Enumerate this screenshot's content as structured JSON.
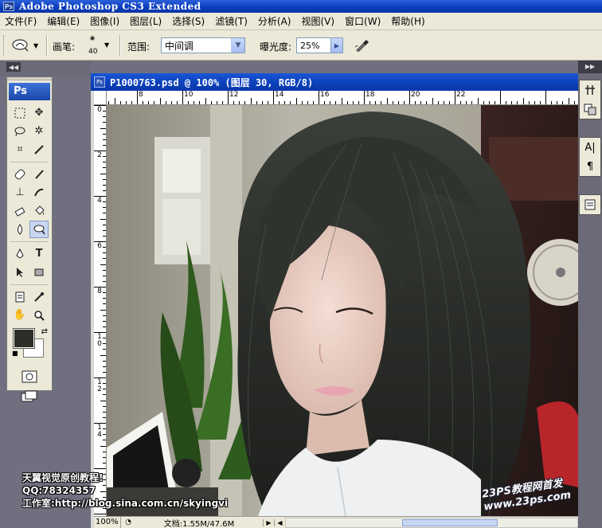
{
  "app": {
    "title": "Adobe Photoshop CS3 Extended",
    "logo": "Ps"
  },
  "menu": [
    "文件(F)",
    "编辑(E)",
    "图像(I)",
    "图层(L)",
    "选择(S)",
    "滤镜(T)",
    "分析(A)",
    "视图(V)",
    "窗口(W)",
    "帮助(H)"
  ],
  "options": {
    "tool_icon": "burn-tool-icon",
    "brush_label": "画笔:",
    "brush_size": "40",
    "range_label": "范围:",
    "range_value": "中间调",
    "exposure_label": "曝光度:",
    "exposure_value": "25%",
    "airbrush_icon": "airbrush-icon"
  },
  "toolbox": {
    "badge": "Ps",
    "tools": [
      [
        "marquee-tool-icon",
        "move-tool-icon"
      ],
      [
        "lasso-tool-icon",
        "magic-wand-tool-icon"
      ],
      [
        "crop-tool-icon",
        "slice-tool-icon"
      ],
      [
        "healing-brush-tool-icon",
        "brush-tool-icon"
      ],
      [
        "clone-stamp-tool-icon",
        "history-brush-tool-icon"
      ],
      [
        "eraser-tool-icon",
        "paint-bucket-tool-icon"
      ],
      [
        "blur-tool-icon",
        "burn-tool-icon"
      ],
      [
        "pen-tool-icon",
        "type-tool-icon"
      ],
      [
        "path-selection-tool-icon",
        "shape-tool-icon"
      ],
      [
        "notes-tool-icon",
        "eyedropper-tool-icon"
      ],
      [
        "hand-tool-icon",
        "zoom-tool-icon"
      ]
    ],
    "foreground_color": "#2e2e28",
    "background_color": "#ffffff"
  },
  "document": {
    "title": "P1000763.psd @ 100% (图层 30, RGB/8)",
    "hruler_labels": [
      "8",
      "10",
      "12",
      "14",
      "16",
      "18",
      "20",
      "22"
    ],
    "vruler_labels": [
      "0",
      "2",
      "4",
      "6",
      "8",
      "10",
      "12",
      "14"
    ],
    "zoom": "100%",
    "doc_info": "文档:1.55M/47.6M"
  },
  "watermark": {
    "line1": "天翼视觉原创教程!",
    "line2": "QQ:78324357",
    "line3": "工作室:http://blog.sina.com.cn/skyingvi",
    "site_title": "23PS教程网首发",
    "site_url": "www.23ps.com"
  },
  "colors": {
    "title_blue": "#0a3cbc",
    "menu_bg": "#ece9d8",
    "workspace": "#6f6f7f"
  }
}
